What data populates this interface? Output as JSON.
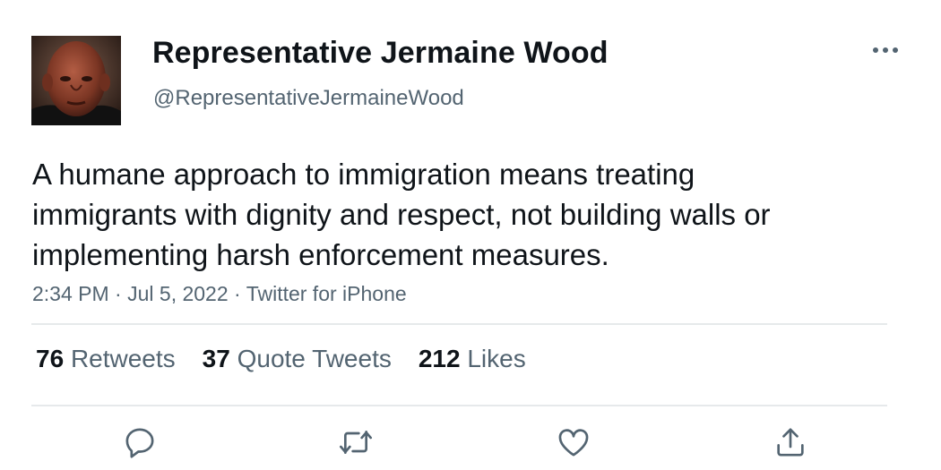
{
  "tweet": {
    "author": {
      "display_name": "Representative Jermaine Wood",
      "handle": "@RepresentativeJermaineWood",
      "avatar_icon": "profile-photo"
    },
    "text": "A humane approach to immigration means treating immigrants with dignity and respect, not building walls or implementing harsh enforcement measures.",
    "time": "2:34 PM",
    "date": "Jul 5, 2022",
    "source": "Twitter for iPhone",
    "separator": "·",
    "stats": {
      "retweets_count": "76",
      "retweets_label": "Retweets",
      "quotes_count": "37",
      "quotes_label": "Quote Tweets",
      "likes_count": "212",
      "likes_label": "Likes"
    },
    "actions": {
      "reply_icon": "reply-icon",
      "retweet_icon": "retweet-icon",
      "like_icon": "heart-icon",
      "share_icon": "share-icon",
      "more_icon": "more-icon"
    },
    "colors": {
      "text_primary": "#0f1419",
      "text_secondary": "#536471",
      "divider": "#e6e9eb"
    }
  }
}
